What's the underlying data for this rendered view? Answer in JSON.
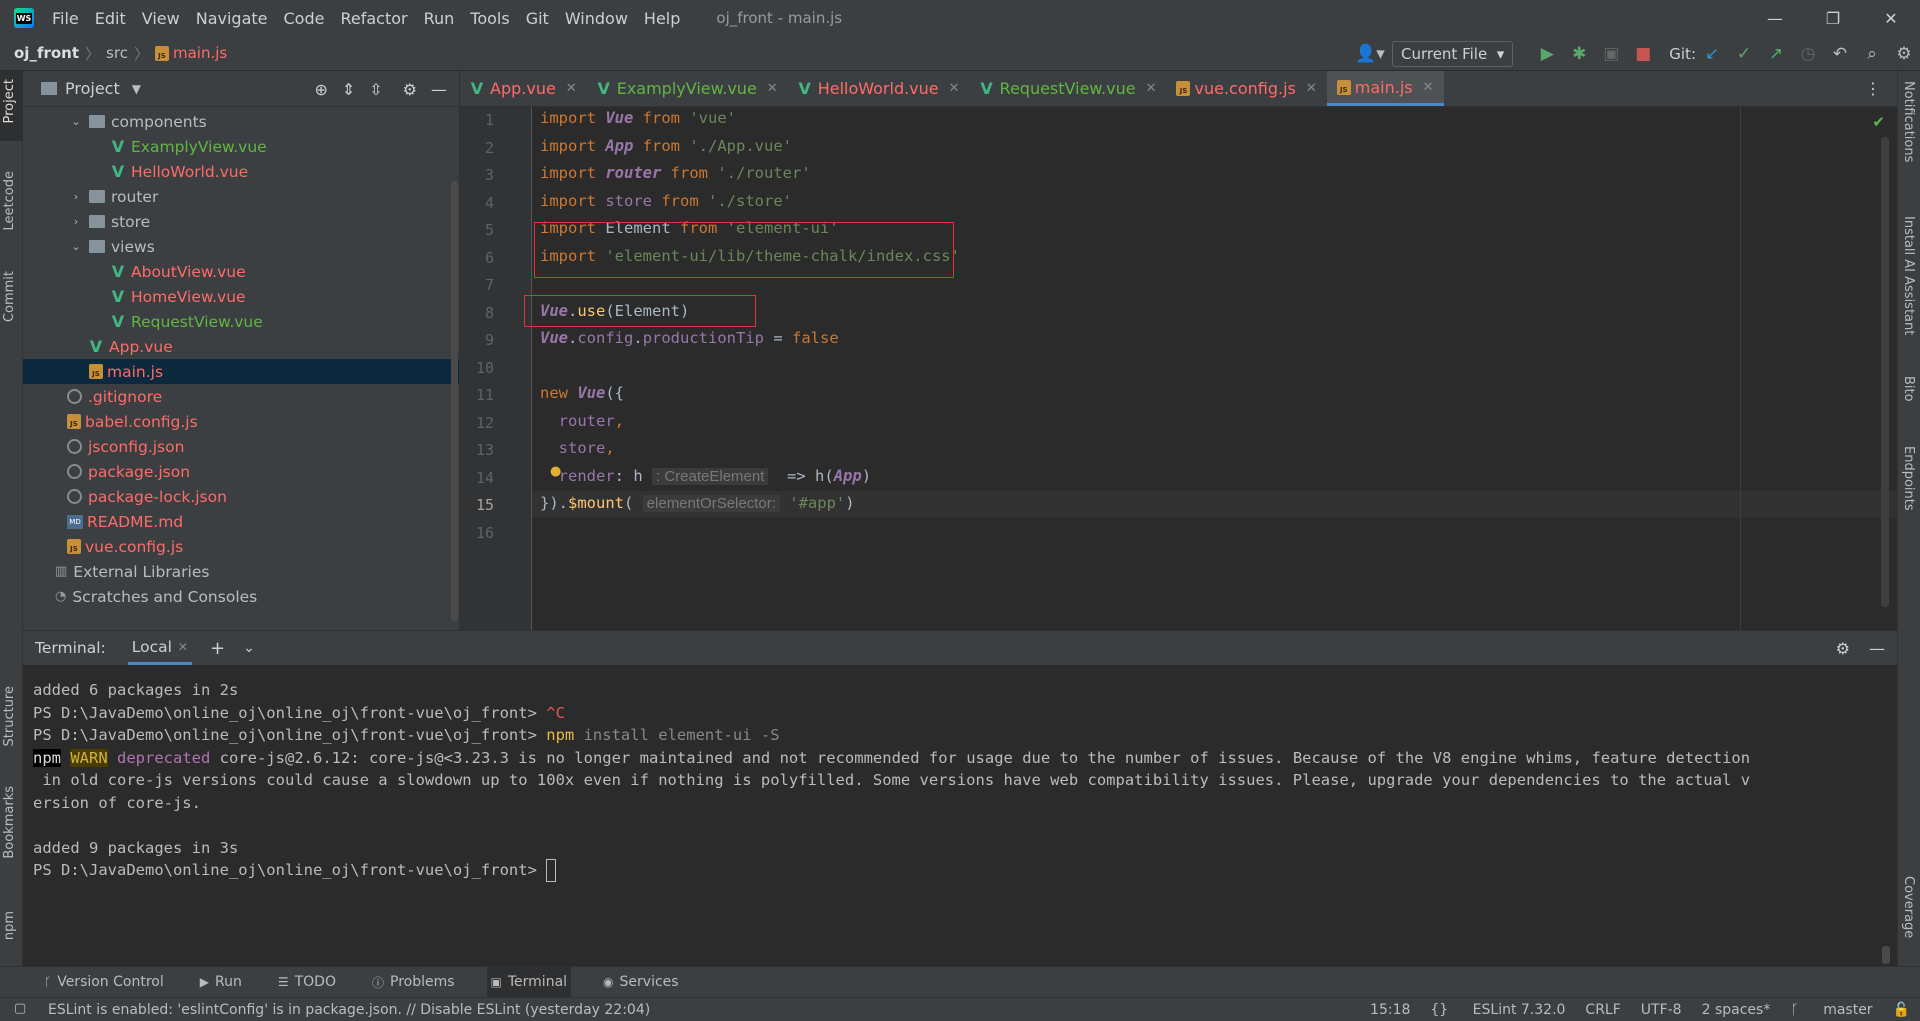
{
  "app": {
    "logo": "WS",
    "window_title": "oj_front - main.js"
  },
  "menu": [
    "File",
    "Edit",
    "View",
    "Navigate",
    "Code",
    "Refactor",
    "Run",
    "Tools",
    "Git",
    "Window",
    "Help"
  ],
  "breadcrumb": {
    "project": "oj_front",
    "folder": "src",
    "file": "main.js"
  },
  "toolbar": {
    "run_config": "Current File",
    "git_label": "Git:"
  },
  "project_panel": {
    "title": "Project",
    "items": [
      {
        "label": "components",
        "type": "folder",
        "depth": 2,
        "expanded": true,
        "color": "plain"
      },
      {
        "label": "ExamplyView.vue",
        "type": "vue",
        "depth": 3,
        "color": "green"
      },
      {
        "label": "HelloWorld.vue",
        "type": "vue",
        "depth": 3,
        "color": "red"
      },
      {
        "label": "router",
        "type": "folder",
        "depth": 2,
        "expanded": false,
        "color": "plain"
      },
      {
        "label": "store",
        "type": "folder",
        "depth": 2,
        "expanded": false,
        "color": "plain"
      },
      {
        "label": "views",
        "type": "folder",
        "depth": 2,
        "expanded": true,
        "color": "plain"
      },
      {
        "label": "AboutView.vue",
        "type": "vue",
        "depth": 3,
        "color": "red"
      },
      {
        "label": "HomeView.vue",
        "type": "vue",
        "depth": 3,
        "color": "red"
      },
      {
        "label": "RequestView.vue",
        "type": "vue",
        "depth": 3,
        "color": "green"
      },
      {
        "label": "App.vue",
        "type": "vue",
        "depth": 2,
        "color": "red"
      },
      {
        "label": "main.js",
        "type": "js",
        "depth": 2,
        "color": "red",
        "selected": true
      },
      {
        "label": ".gitignore",
        "type": "cfg",
        "depth": 1,
        "color": "red"
      },
      {
        "label": "babel.config.js",
        "type": "js",
        "depth": 1,
        "color": "red"
      },
      {
        "label": "jsconfig.json",
        "type": "cfg",
        "depth": 1,
        "color": "red"
      },
      {
        "label": "package.json",
        "type": "cfg",
        "depth": 1,
        "color": "red"
      },
      {
        "label": "package-lock.json",
        "type": "cfg",
        "depth": 1,
        "color": "red"
      },
      {
        "label": "README.md",
        "type": "md",
        "depth": 1,
        "color": "red"
      },
      {
        "label": "vue.config.js",
        "type": "js",
        "depth": 1,
        "color": "red"
      },
      {
        "label": "External Libraries",
        "type": "lib",
        "depth": 0,
        "color": "plain"
      },
      {
        "label": "Scratches and Consoles",
        "type": "scratch",
        "depth": 0,
        "color": "plain"
      }
    ]
  },
  "tabs": [
    {
      "label": "App.vue",
      "type": "vue",
      "color": "red",
      "active": false
    },
    {
      "label": "ExamplyView.vue",
      "type": "vue",
      "color": "green",
      "active": false
    },
    {
      "label": "HelloWorld.vue",
      "type": "vue",
      "color": "red",
      "active": false
    },
    {
      "label": "RequestView.vue",
      "type": "vue",
      "color": "green",
      "active": false
    },
    {
      "label": "vue.config.js",
      "type": "js",
      "color": "red",
      "active": false
    },
    {
      "label": "main.js",
      "type": "js",
      "color": "red",
      "active": true
    }
  ],
  "editor": {
    "current_line": 15,
    "lines": [
      [
        [
          "kw",
          "import "
        ],
        [
          "cls",
          "Vue"
        ],
        [
          "kw",
          " from "
        ],
        [
          "str",
          "'vue'"
        ]
      ],
      [
        [
          "kw",
          "import "
        ],
        [
          "cls",
          "App"
        ],
        [
          "kw",
          " from "
        ],
        [
          "str",
          "'./App.vue'"
        ]
      ],
      [
        [
          "kw",
          "import "
        ],
        [
          "cls",
          "router"
        ],
        [
          "kw",
          " from "
        ],
        [
          "str",
          "'./router'"
        ]
      ],
      [
        [
          "kw",
          "import "
        ],
        [
          "prop",
          "store"
        ],
        [
          "kw",
          " from "
        ],
        [
          "str",
          "'./store'"
        ]
      ],
      [
        [
          "kw",
          "import "
        ],
        [
          "txt",
          "Element"
        ],
        [
          "kw",
          " from "
        ],
        [
          "str",
          "'element-ui'"
        ]
      ],
      [
        [
          "kw",
          "import "
        ],
        [
          "str",
          "'element-ui/lib/theme-chalk/index.css'"
        ]
      ],
      [],
      [
        [
          "cls",
          "Vue"
        ],
        [
          "txt",
          "."
        ],
        [
          "fn",
          "use"
        ],
        [
          "txt",
          "(Element)"
        ]
      ],
      [
        [
          "cls",
          "Vue"
        ],
        [
          "txt",
          "."
        ],
        [
          "prop",
          "config"
        ],
        [
          "txt",
          "."
        ],
        [
          "prop",
          "productionTip"
        ],
        [
          "txt",
          " = "
        ],
        [
          "kw",
          "false"
        ]
      ],
      [],
      [
        [
          "kw",
          "new "
        ],
        [
          "cls",
          "Vue"
        ],
        [
          "txt",
          "({"
        ]
      ],
      [
        [
          "txt",
          "  "
        ],
        [
          "prop",
          "router"
        ],
        [
          "kw",
          ","
        ]
      ],
      [
        [
          "txt",
          "  "
        ],
        [
          "prop",
          "store"
        ],
        [
          "kw",
          ","
        ]
      ],
      [
        [
          "txt",
          "  "
        ],
        [
          "prop",
          "render"
        ],
        [
          "txt",
          ": h "
        ],
        [
          "hint",
          ": CreateElement"
        ],
        [
          "txt",
          "  => h("
        ],
        [
          "cls",
          "App"
        ],
        [
          "txt",
          ")"
        ]
      ],
      [
        [
          "txt",
          "})."
        ],
        [
          "fn",
          "$mount"
        ],
        [
          "txt",
          "( "
        ],
        [
          "hint",
          "elementOrSelector:"
        ],
        [
          "str",
          " '#app'"
        ],
        [
          "txt",
          ")"
        ]
      ],
      []
    ]
  },
  "terminal": {
    "label": "Terminal:",
    "tab": "Local",
    "lines": [
      {
        "text": "added 6 packages in 2s"
      },
      {
        "prompt": "PS D:\\JavaDemo\\online_oj\\online_oj\\front-vue\\oj_front> ",
        "ctrlc": "^C"
      },
      {
        "prompt": "PS D:\\JavaDemo\\online_oj\\online_oj\\front-vue\\oj_front> ",
        "cmd": "npm",
        "args": " install element-ui -S"
      },
      {
        "npm": "npm",
        "warn": "WARN",
        "dep": "deprecated",
        "text": " core-js@2.6.12: core-js@<3.23.3 is no longer maintained and not recommended for usage due to the number of issues. Because of the V8 engine whims, feature detection"
      },
      {
        "text": " in old core-js versions could cause a slowdown up to 100x even if nothing is polyfilled. Some versions have web compatibility issues. Please, upgrade your dependencies to the actual v"
      },
      {
        "text": "ersion of core-js."
      },
      {
        "text": ""
      },
      {
        "text": "added 9 packages in 3s"
      },
      {
        "prompt": "PS D:\\JavaDemo\\online_oj\\online_oj\\front-vue\\oj_front> ",
        "cursor": true
      }
    ]
  },
  "left_strip": [
    "Project",
    "Leetcode",
    "Commit",
    "Structure",
    "Bookmarks",
    "npm"
  ],
  "right_strip": [
    "Notifications",
    "Install AI Assistant",
    "Bito",
    "Endpoints",
    "Coverage"
  ],
  "bottom_tools": [
    {
      "label": "Version Control",
      "icon": "branch-icon"
    },
    {
      "label": "Run",
      "icon": "play-icon"
    },
    {
      "label": "TODO",
      "icon": "list-icon"
    },
    {
      "label": "Problems",
      "icon": "info-icon"
    },
    {
      "label": "Terminal",
      "icon": "terminal-icon",
      "active": true
    },
    {
      "label": "Services",
      "icon": "services-icon"
    }
  ],
  "status": {
    "message": "ESLint is enabled: 'eslintConfig' is in package.json. // Disable ESLint (yesterday 22:04)",
    "position": "15:18",
    "eslint": "ESLint 7.32.0",
    "line_sep": "CRLF",
    "encoding": "UTF-8",
    "indent": "2 spaces*",
    "branch": "master"
  }
}
